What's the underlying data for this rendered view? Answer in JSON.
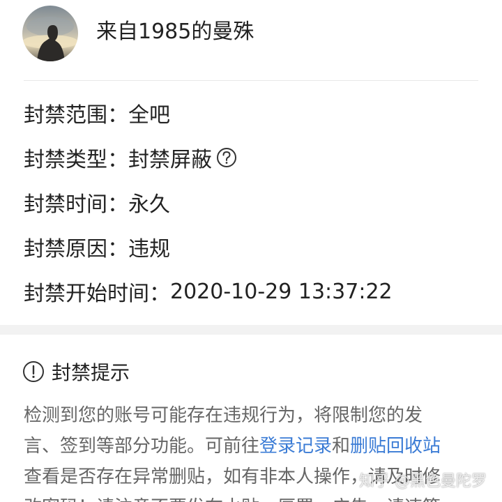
{
  "header": {
    "username": "来自1985的曼殊"
  },
  "ban_info": {
    "scope": {
      "label": "封禁范围：",
      "value": "全吧"
    },
    "type": {
      "label": "封禁类型：",
      "value": "封禁屏蔽"
    },
    "duration": {
      "label": "封禁时间：",
      "value": "永久"
    },
    "reason": {
      "label": "封禁原因：",
      "value": "违规"
    },
    "start_time": {
      "label": "封禁开始时间：",
      "value": "2020-10-29 13:37:22"
    }
  },
  "notice": {
    "title": "封禁提示",
    "line1": "检测到您的账号可能存在违规行为，将限制您的发",
    "line2_prefix": "言、签到等部分功能。可前往",
    "link_login_records": "登录记录",
    "line2_mid": "和",
    "link_recycle_bin": "删贴回收站",
    "line3": "查看是否存在异常删贴，如有非本人操作，请及时修",
    "line4": "改密码！请注意不要发布水贴、厚置、广告、请违等"
  },
  "watermark": "知乎 @黑色曼陀罗",
  "colors": {
    "link": "#3a7bd5",
    "body_text": "#666666",
    "primary_text": "#222222",
    "band": "#f2f2f2"
  }
}
